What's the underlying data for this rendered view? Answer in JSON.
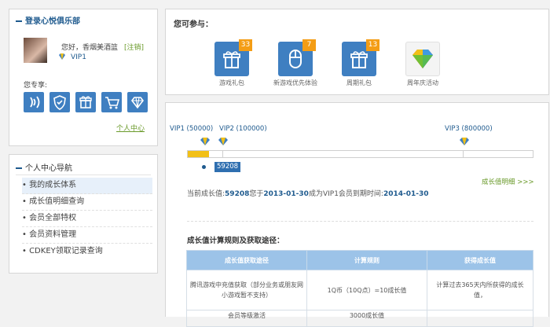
{
  "sidebar": {
    "login_title": "登录心悦俱乐部",
    "greeting": "您好，香烟美酒篮",
    "logout": "[注销]",
    "vip_level": "VIP1",
    "exclusive_label": "您专享:",
    "exclusive_icons": [
      "voice-icon",
      "shield-icon",
      "gift-icon",
      "cart-icon",
      "diamond-icon"
    ],
    "center_link": "个人中心",
    "nav_title": "个人中心导航",
    "nav_items": [
      "我的成长体系",
      "成长值明细查询",
      "会员全部特权",
      "会员资料管理",
      "CDKEY领取记录查询"
    ]
  },
  "participate": {
    "title": "您可参与：",
    "items": [
      {
        "label": "游戏礼包",
        "badge": "33",
        "icon": "gift-icon"
      },
      {
        "label": "新游戏优先体验",
        "badge": "7",
        "icon": "mouse-icon"
      },
      {
        "label": "周期礼包",
        "badge": "13",
        "icon": "gift-icon"
      },
      {
        "label": "周年庆活动",
        "badge": "",
        "icon": "colorful-diamond-icon"
      }
    ]
  },
  "growth": {
    "markers": [
      {
        "label": "VIP1 (50000)",
        "value": 50000
      },
      {
        "label": "VIP2 (100000)",
        "value": 100000
      },
      {
        "label": "VIP3 (800000)",
        "value": 800000
      }
    ],
    "current_value": 59208,
    "current_label": "59208",
    "detail_link": "成长值明细 >>>",
    "summary": {
      "prefix": "当前成长值:",
      "value": "59208",
      "mid1": "您于",
      "date1": "2013-01-30",
      "mid2": "成为VIP1会员到期时间:",
      "date2": "2014-01-30"
    },
    "rules_title": "成长值计算规则及获取途径：",
    "table": {
      "headers": [
        "成长值获取途径",
        "计算规则",
        "获得成长值"
      ],
      "rows": [
        [
          "腾讯游戏中充值获取（部分业务或朋友网小游戏暂不支持）",
          "1Q币（10Q点）=10成长值",
          "计算过去365天内所获得的成长值，"
        ],
        [
          "会员等级激活",
          "3000成长值",
          ""
        ]
      ]
    }
  },
  "colors": {
    "accent": "#1e5a8e",
    "tile": "#3f7fc1",
    "badge": "#f49d15",
    "progress": "#f2c017"
  }
}
